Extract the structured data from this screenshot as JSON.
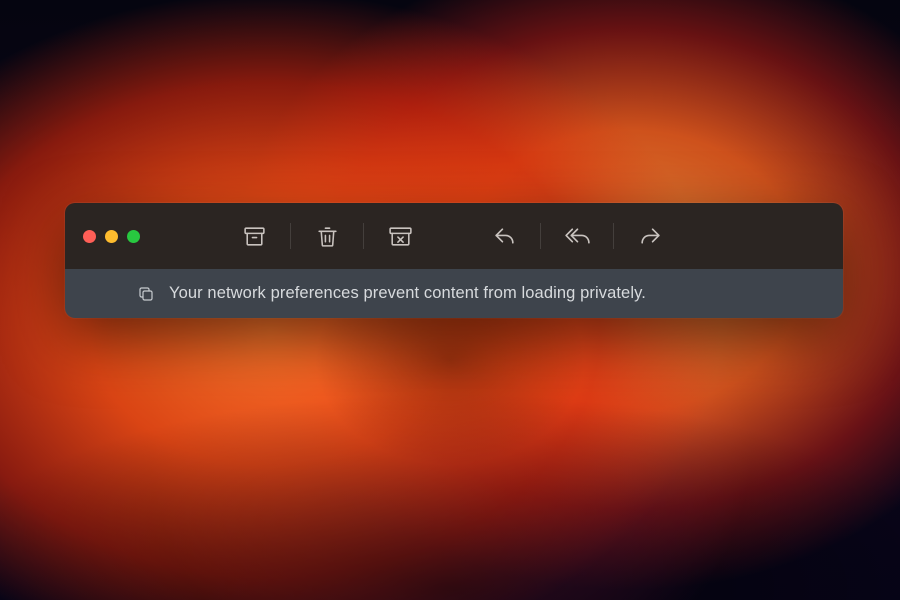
{
  "banner": {
    "message": "Your network preferences prevent content from loading privately."
  },
  "traffic_lights": {
    "close": "#ff5f57",
    "minimize": "#febc2e",
    "zoom": "#28c840"
  },
  "toolbar": {
    "archive": "archive",
    "trash": "trash",
    "junk": "junk",
    "reply": "reply",
    "reply_all": "reply-all",
    "forward": "forward"
  }
}
